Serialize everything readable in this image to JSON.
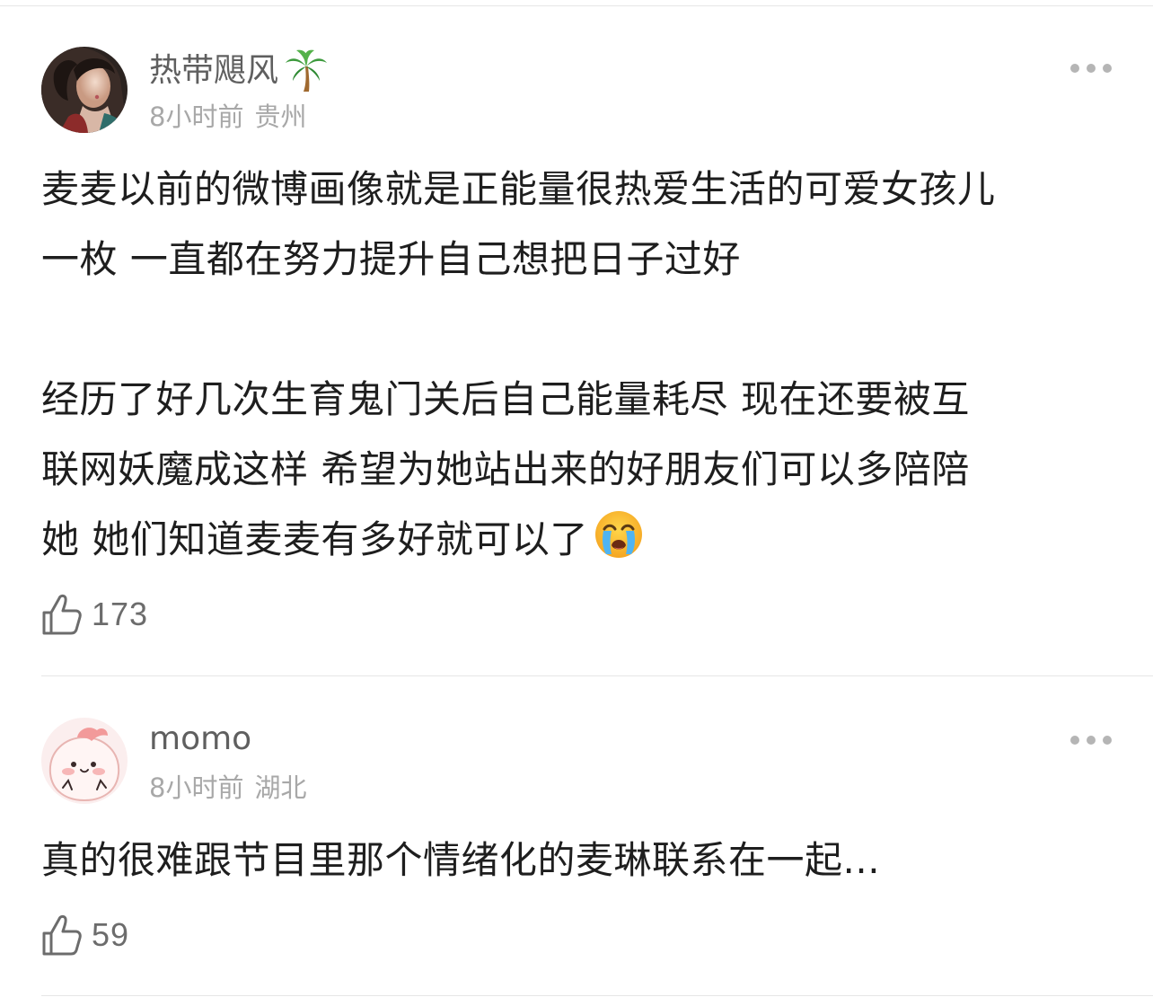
{
  "comments": [
    {
      "author": "热带飓风",
      "author_emoji": "palm-tree",
      "time": "8小时前",
      "location": "贵州",
      "text_paragraphs": [
        [
          "麦麦以前的微博画像就是正能量很热爱生活的可爱女孩儿",
          "一枚 一直都在努力提升自己想把日子过好"
        ],
        [
          "经历了好几次生育鬼门关后自己能量耗尽 现在还要被互",
          "联网妖魔成这样 希望为她站出来的好朋友们可以多陪陪",
          "她 她们知道麦麦有多好就可以了"
        ]
      ],
      "trailing_emoji": "loudly-crying-face",
      "likes": "173"
    },
    {
      "author": "momo",
      "time": "8小时前",
      "location": "湖北",
      "text": "真的很难跟节目里那个情绪化的麦琳联系在一起...",
      "likes": "59"
    }
  ],
  "icons": {
    "like": "thumbs-up-outline-icon",
    "more": "more-dots-icon"
  },
  "colors": {
    "text": "#1e1e1e",
    "author": "#5f5f5f",
    "meta": "#a8a8a8",
    "divider": "#e6e6e6",
    "dots": "#b5b5b5"
  }
}
